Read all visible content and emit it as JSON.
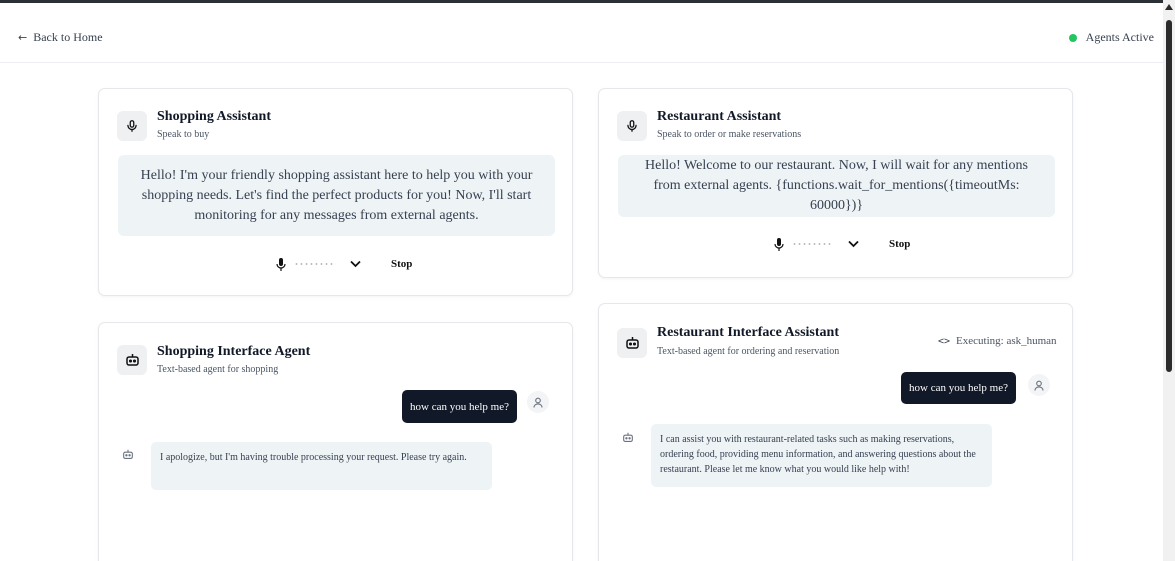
{
  "header": {
    "back_label": "Back to Home",
    "status_label": "Agents Active",
    "status_color": "#22c55e"
  },
  "shopping_voice": {
    "icon": "microphone-icon",
    "title": "Shopping Assistant",
    "subtitle": "Speak to buy",
    "greeting": "Hello! I'm your friendly shopping assistant here to help you with your shopping needs. Let's find the perfect products for you! Now, I'll start monitoring for any messages from external agents.",
    "stop_label": "Stop"
  },
  "restaurant_voice": {
    "icon": "microphone-icon",
    "title": "Restaurant Assistant",
    "subtitle": "Speak to order or make reservations",
    "greeting": "Hello! Welcome to our restaurant. Now, I will wait for any mentions from external agents. {functions.wait_for_mentions({timeoutMs: 60000})}",
    "stop_label": "Stop"
  },
  "shopping_text": {
    "icon": "robot-icon",
    "title": "Shopping Interface Agent",
    "subtitle": "Text-based agent for shopping",
    "messages": [
      {
        "role": "user",
        "text": "how can you help me?"
      },
      {
        "role": "agent",
        "text": "I apologize, but I'm having trouble processing your request. Please try again."
      }
    ]
  },
  "restaurant_text": {
    "icon": "robot-icon",
    "title": "Restaurant Interface Assistant",
    "subtitle": "Text-based agent for ordering and reservation",
    "executing_label": "Executing: ask_human",
    "messages": [
      {
        "role": "user",
        "text": "how can you help me?"
      },
      {
        "role": "agent",
        "text": "I can assist you with restaurant-related tasks such as making reservations, ordering food, providing menu information, and answering questions about the restaurant. Please let me know what you would like help with!"
      }
    ]
  },
  "colors": {
    "accent_dark": "#111827",
    "bubble_bg": "#eef3f5",
    "card_border": "#e5e7eb"
  }
}
